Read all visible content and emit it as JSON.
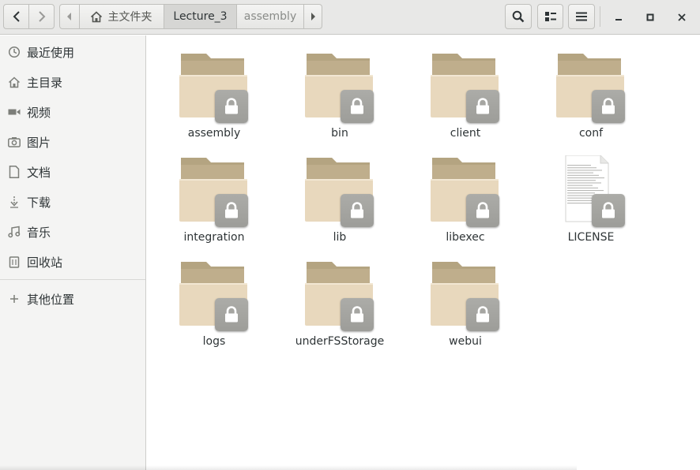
{
  "toolbar": {
    "back_icon": "chevron-left-icon",
    "forward_icon": "chevron-right-icon",
    "search_icon": "search-icon",
    "view_icon": "list-view-icon",
    "menu_icon": "hamburger-menu-icon",
    "minimize_icon": "minimize-icon",
    "maximize_icon": "maximize-icon",
    "close_icon": "close-icon"
  },
  "pathbar": {
    "home_label": "主文件夹",
    "current_label": "Lecture_3",
    "child_label": "assembly"
  },
  "sidebar": {
    "items": [
      {
        "label": "最近使用",
        "icon": "clock-icon"
      },
      {
        "label": "主目录",
        "icon": "home-icon"
      },
      {
        "label": "视频",
        "icon": "video-icon"
      },
      {
        "label": "图片",
        "icon": "camera-icon"
      },
      {
        "label": "文档",
        "icon": "document-icon"
      },
      {
        "label": "下载",
        "icon": "download-icon"
      },
      {
        "label": "音乐",
        "icon": "music-icon"
      },
      {
        "label": "回收站",
        "icon": "trash-icon"
      }
    ],
    "other_locations": {
      "label": "其他位置",
      "icon": "plus-icon"
    }
  },
  "files": [
    {
      "name": "assembly",
      "type": "folder",
      "locked": true
    },
    {
      "name": "bin",
      "type": "folder",
      "locked": true
    },
    {
      "name": "client",
      "type": "folder",
      "locked": true
    },
    {
      "name": "conf",
      "type": "folder",
      "locked": true
    },
    {
      "name": "integration",
      "type": "folder",
      "locked": true
    },
    {
      "name": "lib",
      "type": "folder",
      "locked": true
    },
    {
      "name": "libexec",
      "type": "folder",
      "locked": true
    },
    {
      "name": "LICENSE",
      "type": "text-file",
      "locked": true
    },
    {
      "name": "logs",
      "type": "folder",
      "locked": true
    },
    {
      "name": "underFSStorage",
      "type": "folder",
      "locked": true
    },
    {
      "name": "webui",
      "type": "folder",
      "locked": true
    }
  ],
  "colors": {
    "folder_back": "#bfae8c",
    "folder_front": "#e8d8bd",
    "lock_badge": "#9d9d99"
  }
}
